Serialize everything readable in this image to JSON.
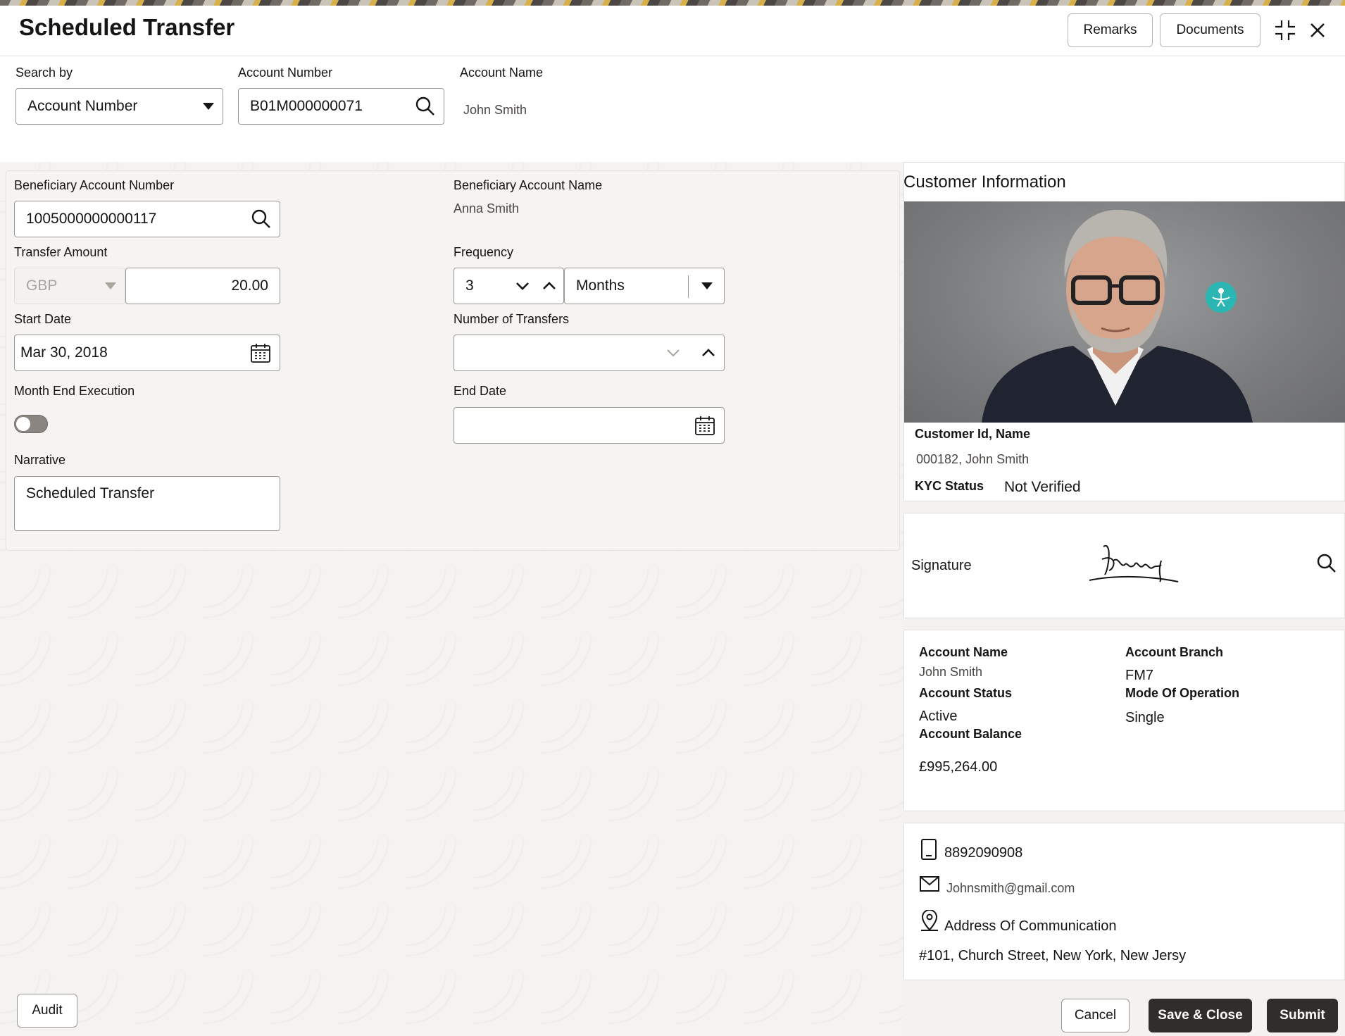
{
  "header": {
    "title": "Scheduled Transfer",
    "remarks_label": "Remarks",
    "documents_label": "Documents"
  },
  "search": {
    "search_by_label": "Search by",
    "search_by_value": "Account Number",
    "account_number_label": "Account Number",
    "account_number_value": "B01M000000071",
    "account_name_label": "Account Name",
    "account_name_value": "John Smith"
  },
  "form": {
    "beneficiary_account_number_label": "Beneficiary Account Number",
    "beneficiary_account_number_value": "1005000000000117",
    "beneficiary_account_name_label": "Beneficiary Account Name",
    "beneficiary_account_name_value": "Anna Smith",
    "transfer_amount_label": "Transfer Amount",
    "currency_value": "GBP",
    "amount_value": "20.00",
    "frequency_label": "Frequency",
    "frequency_value": "3",
    "frequency_unit_value": "Months",
    "start_date_label": "Start Date",
    "start_date_value": "Mar 30, 2018",
    "number_of_transfers_label": "Number of Transfers",
    "number_of_transfers_value": "",
    "month_end_execution_label": "Month End Execution",
    "month_end_execution_on": false,
    "end_date_label": "End Date",
    "end_date_value": "",
    "narrative_label": "Narrative",
    "narrative_value": "Scheduled Transfer"
  },
  "customer": {
    "section_title": "Customer Information",
    "id_name_label": "Customer Id, Name",
    "id_name_value": "000182, John Smith",
    "kyc_label": "KYC Status",
    "kyc_value": "Not Verified",
    "signature_label": "Signature"
  },
  "account": {
    "name_label": "Account Name",
    "name_value": "John Smith",
    "branch_label": "Account Branch",
    "branch_value": "FM7",
    "status_label": "Account Status",
    "status_value": "Active",
    "mode_label": "Mode Of Operation",
    "mode_value": "Single",
    "balance_label": "Account Balance",
    "balance_value": "£995,264.00"
  },
  "contact": {
    "phone": "8892090908",
    "email": "Johnsmith@gmail.com",
    "address_label": "Address Of Communication",
    "address_value": "#101, Church Street, New York, New Jersy"
  },
  "footer": {
    "audit_label": "Audit",
    "cancel_label": "Cancel",
    "save_close_label": "Save & Close",
    "submit_label": "Submit"
  },
  "colors": {
    "primary_button": "#312d2a",
    "accent_teal": "#2bb5b3"
  }
}
